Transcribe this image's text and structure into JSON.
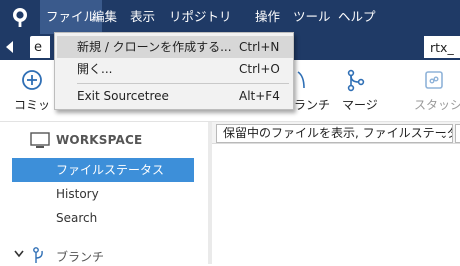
{
  "menubar": {
    "items": [
      {
        "label": "ファイル"
      },
      {
        "label": "編集"
      },
      {
        "label": "表示"
      },
      {
        "label": "リポジトリ"
      },
      {
        "label": "操作"
      },
      {
        "label": "ツール"
      },
      {
        "label": "ヘルプ"
      }
    ]
  },
  "tabs": {
    "left_partial": "e",
    "right_partial": "rtx_"
  },
  "toolbar": {
    "commit_partial": "コミッ",
    "branch_partial": "ランチ",
    "merge": "マージ",
    "stash": "スタッシュ"
  },
  "file_menu": {
    "items": [
      {
        "label": "新規 / クローンを作成する...",
        "shortcut": "Ctrl+N"
      },
      {
        "label": "開く...",
        "shortcut": "Ctrl+O"
      },
      {
        "label": "Exit Sourcetree",
        "shortcut": "Alt+F4"
      }
    ]
  },
  "sidebar": {
    "workspace_title": "WORKSPACE",
    "items": [
      {
        "label": "ファイルステータス"
      },
      {
        "label": "History"
      },
      {
        "label": "Search"
      }
    ],
    "branches_label": "ブランチ"
  },
  "main": {
    "filter_value": "保留中のファイルを表示, ファイルステータス順"
  },
  "colors": {
    "menubar_bg": "#1f3a66",
    "selected_bg": "#3d8fd9",
    "dropdown_bg": "#f2f2f2"
  }
}
